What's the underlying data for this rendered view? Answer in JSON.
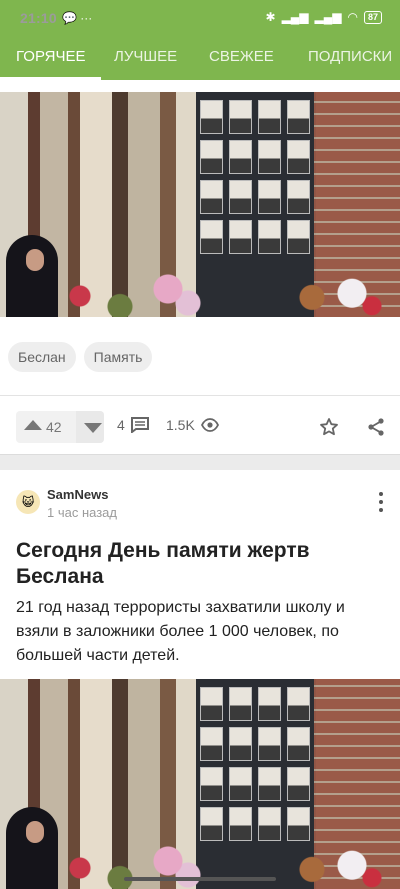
{
  "status_bar": {
    "time": "21:10",
    "left_icons": "💬 ···",
    "right_icons": [
      "bluetooth-icon",
      "signal-icon",
      "signal-icon",
      "wifi-icon"
    ],
    "battery": "87"
  },
  "tabs": [
    {
      "label": "Горячее",
      "active": true
    },
    {
      "label": "Лучшее",
      "active": false
    },
    {
      "label": "Свежее",
      "active": false
    },
    {
      "label": "Подписки",
      "active": false
    }
  ],
  "post1": {
    "tags": [
      "Беслан",
      "Память"
    ],
    "rating": "42",
    "comments": "4",
    "views": "1.5K"
  },
  "post2": {
    "author": "SamNews",
    "time": "1 час назад",
    "title": "Сегодня День памяти жертв Беслана",
    "text": "21 год назад террористы захватили школу и взяли в заложники более 1 000 человек, по большей части детей."
  },
  "colors": {
    "brand": "#7fb64e",
    "tag_bg": "#eeeeee",
    "text": "#222222",
    "muted": "#9b9b9b"
  }
}
